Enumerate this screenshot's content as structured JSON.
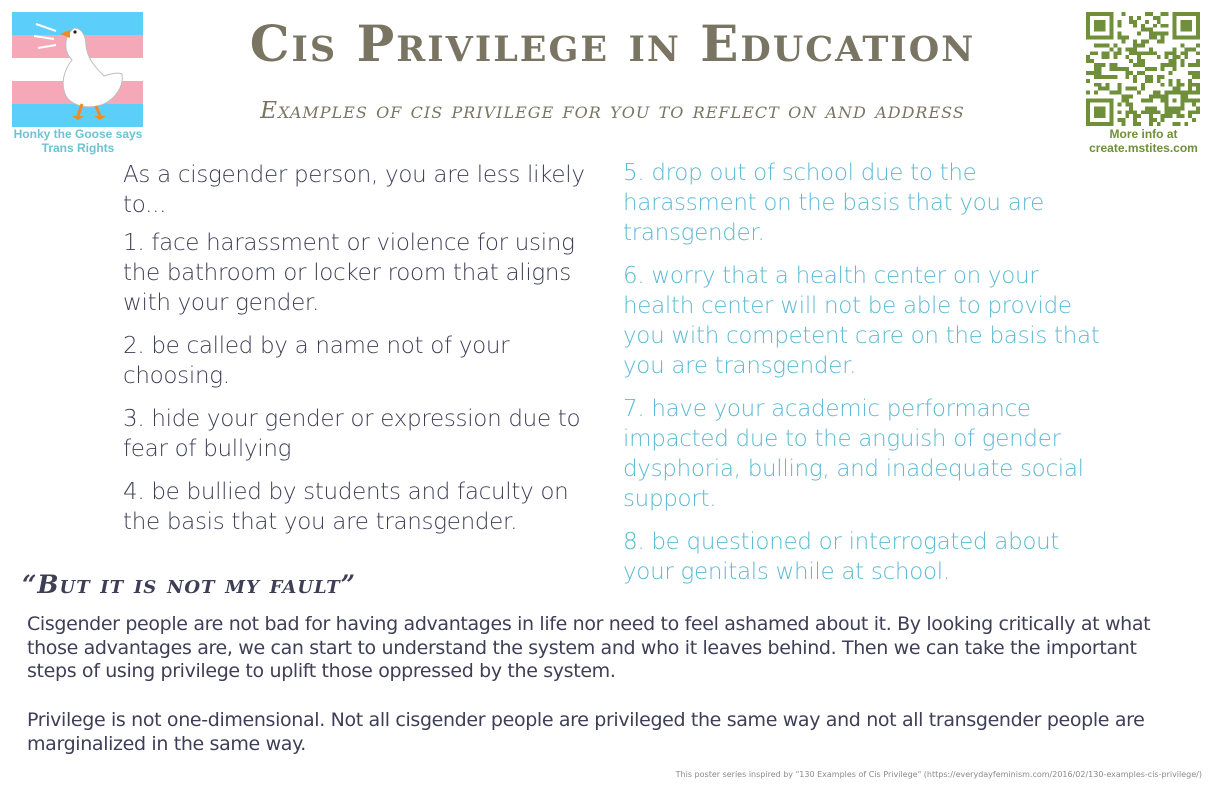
{
  "header": {
    "title": "Cis Privilege in Education",
    "subtitle": "Examples of cis privilege for you to reflect on and address"
  },
  "logo": {
    "caption": "Honky the Goose says Trans Rights",
    "flag_colors": [
      "#5bcefa",
      "#f5a9b8",
      "#ffffff",
      "#f5a9b8",
      "#5bcefa"
    ]
  },
  "qr": {
    "caption_line1": "More info at",
    "caption_line2": "create.mstites.com",
    "color": "#6f8f3a"
  },
  "left_column": {
    "intro": "As a cisgender person, you are less likely to...",
    "items": [
      "1. face harassment or violence for using the bathroom or locker room that aligns with your gender.",
      "2. be called by a name not of your choosing.",
      "3. hide your gender or expression due to fear of bullying",
      "4. be bullied by students and faculty on the basis that you are transgender."
    ]
  },
  "right_column": {
    "items": [
      "5. drop out of school due to the harassment on the basis that you are transgender.",
      "6. worry that a health center on your health center will not be able to provide you with competent care on the basis that you are transgender.",
      "7. have your academic performance impacted due to the anguish of gender dysphoria, bulling, and inadequate social support.",
      "8. be questioned or interrogated about your genitals while at school."
    ]
  },
  "fault_section": {
    "heading": "“But it is not my fault”",
    "paragraph1": "Cisgender people are not bad for having advantages in life nor need to feel ashamed about it. By looking critically at what those advantages are, we can start to understand the system and who it leaves behind. Then we can take the im­portant steps of using privilege to uplift those oppressed by the system.",
    "paragraph2": "Privilege is not one-dimensional. Not all cisgender people are privileged the same way and not all transgender people are marginalized in the same way."
  },
  "footer": {
    "credit": "This poster series inspired by \"130 Examples of Cis Privilege\"  (https://everydayfeminism.com/2016/02/130-examples-cis-privilege/)"
  },
  "colors": {
    "title": "#7a7563",
    "left_text": "#3e3e56",
    "right_text": "#5cbad4",
    "caption_blue": "#6ec3d3"
  }
}
